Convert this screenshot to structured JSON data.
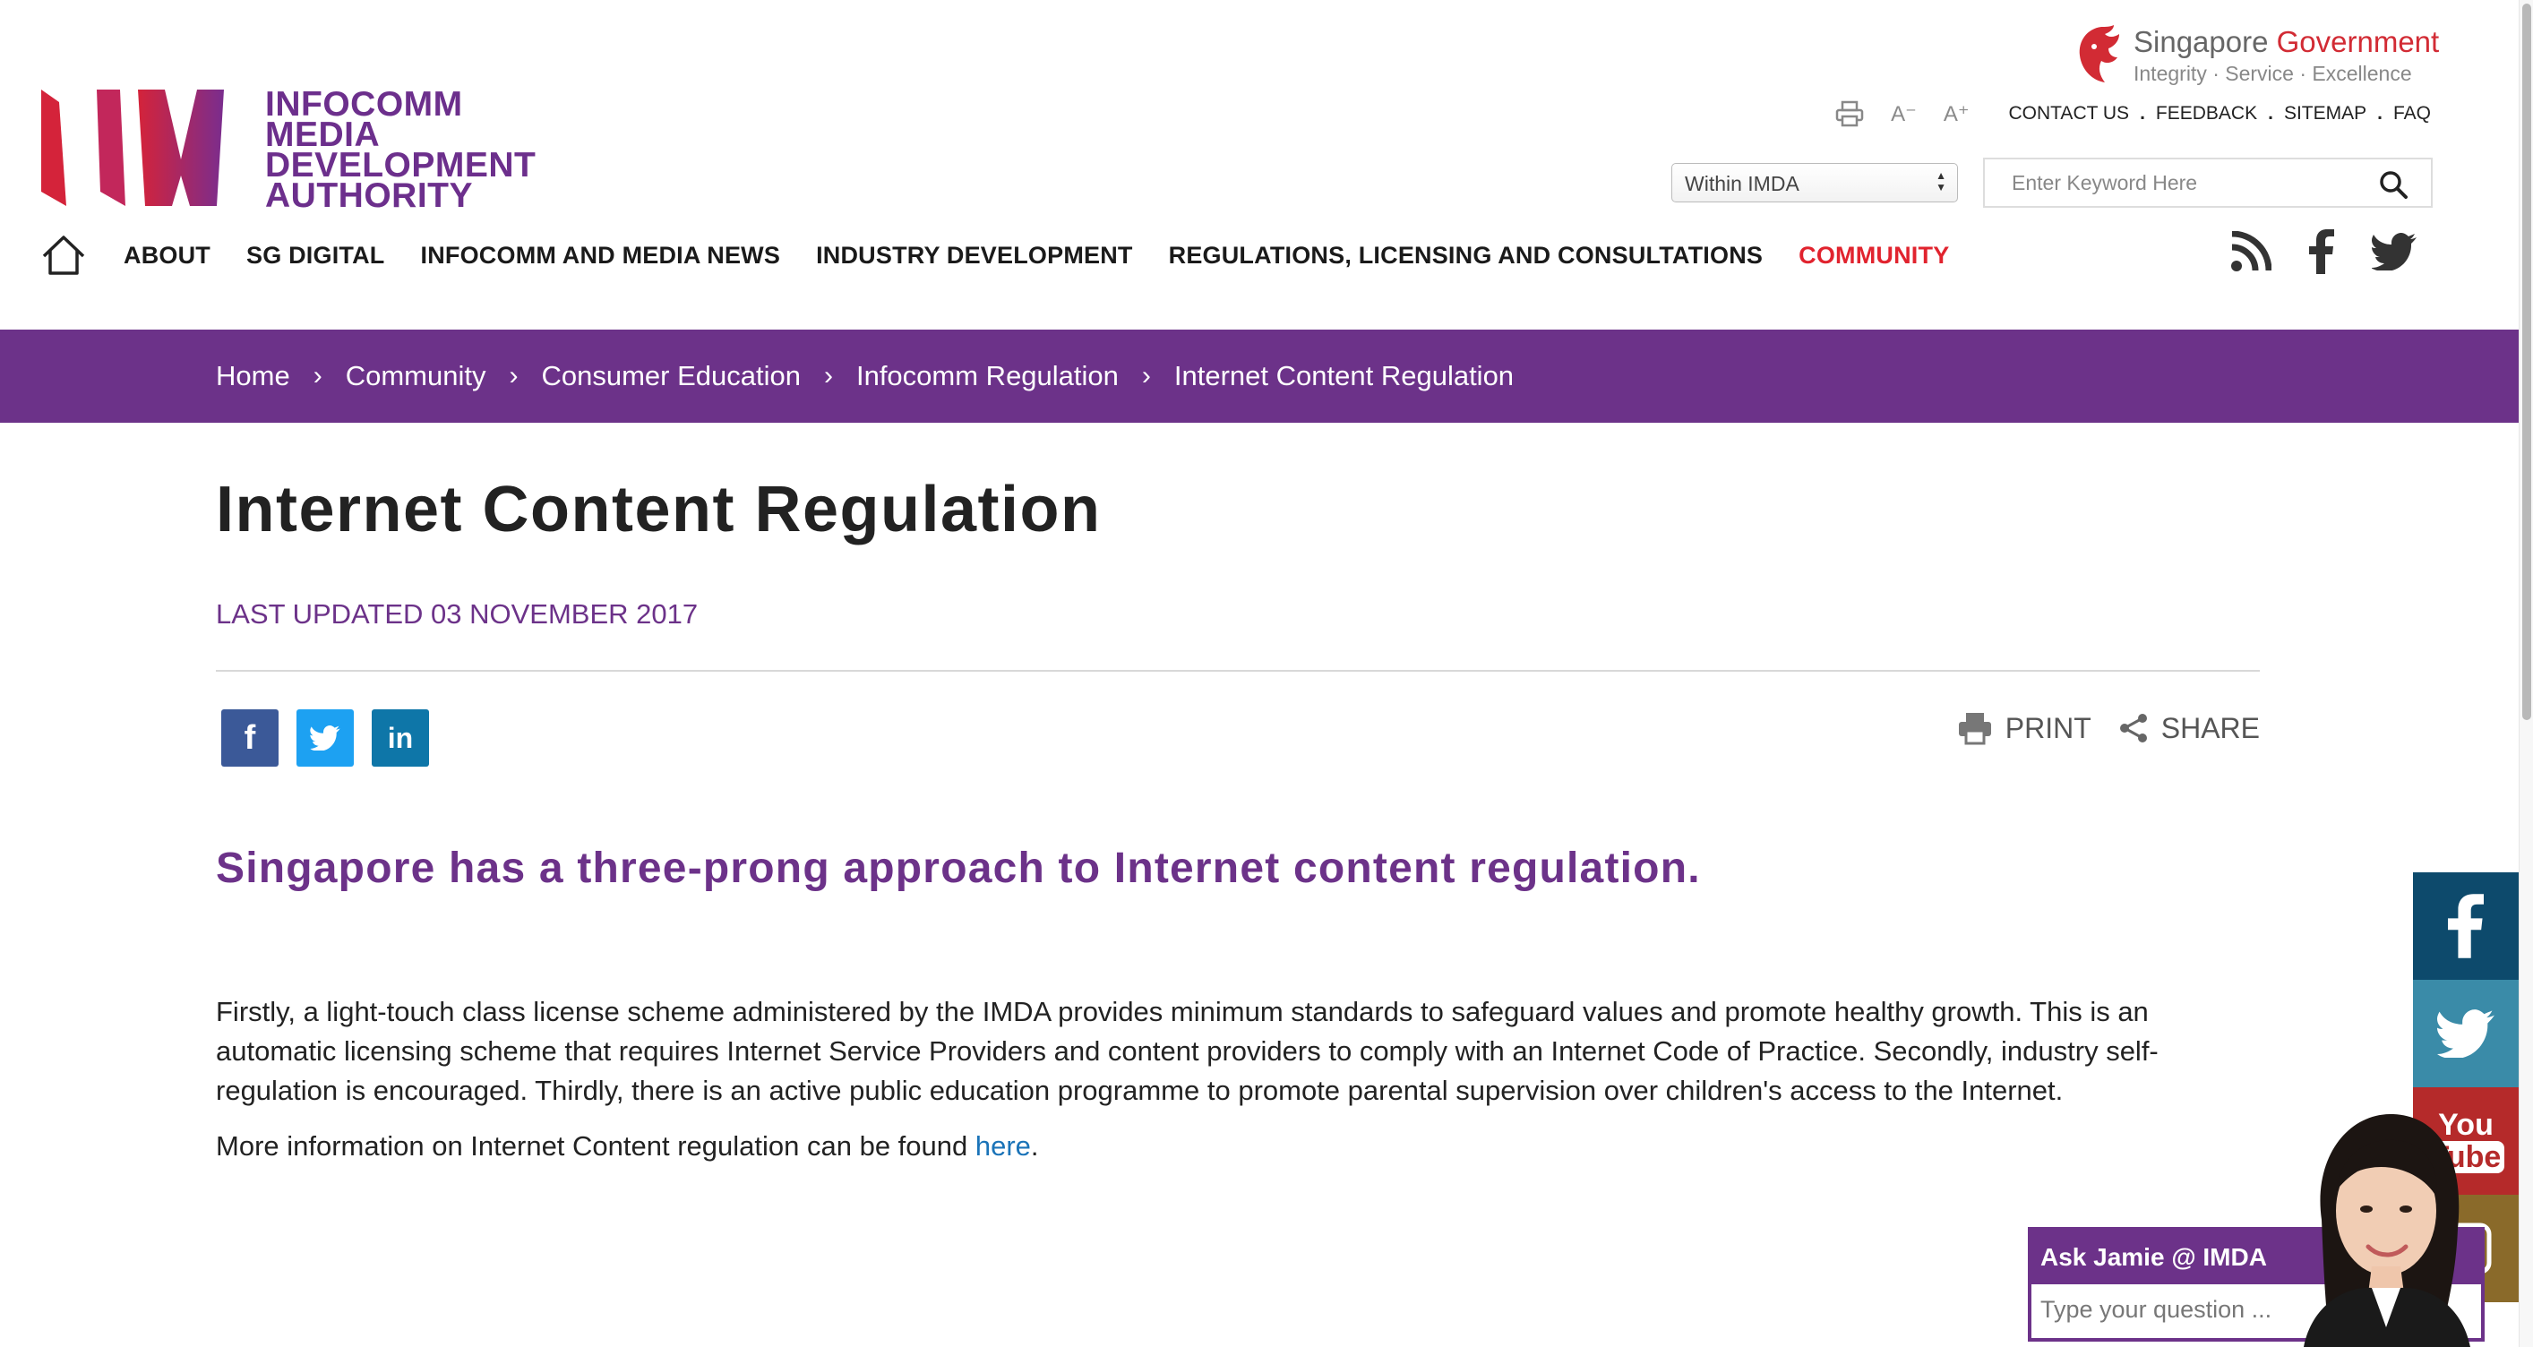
{
  "logo": {
    "lines": [
      "INFOCOMM",
      "MEDIA",
      "DEVELOPMENT",
      "AUTHORITY"
    ],
    "brand_color": "#6c2f8c",
    "accent_color": "#d22b34"
  },
  "sg_gov": {
    "title_part1": "Singapore ",
    "title_part2": "Government",
    "tagline": "Integrity · Service · Excellence"
  },
  "utility": {
    "font_decrease": "A⁻",
    "font_increase": "A⁺",
    "links": [
      "CONTACT US",
      "FEEDBACK",
      "SITEMAP",
      "FAQ"
    ],
    "separator": "."
  },
  "search": {
    "scope_value": "Within IMDA",
    "placeholder": "Enter Keyword Here"
  },
  "nav": {
    "items": [
      {
        "label": "ABOUT"
      },
      {
        "label": "SG DIGITAL"
      },
      {
        "label": "INFOCOMM AND MEDIA NEWS"
      },
      {
        "label": "INDUSTRY DEVELOPMENT"
      },
      {
        "label": "REGULATIONS, LICENSING AND CONSULTATIONS"
      },
      {
        "label": "COMMUNITY"
      }
    ],
    "active_color": "#e1232e"
  },
  "breadcrumb": {
    "items": [
      "Home",
      "Community",
      "Consumer Education",
      "Infocomm Regulation",
      "Internet Content Regulation"
    ],
    "bg_color": "#6c3289"
  },
  "page": {
    "title": "Internet Content Regulation",
    "updated": "LAST UPDATED 03 NOVEMBER 2017",
    "print_label": "PRINT",
    "share_label": "SHARE",
    "intro": "Singapore has a three-prong approach to Internet content regulation.",
    "paragraph": "Firstly, a light-touch class license scheme administered by the IMDA provides minimum standards to safeguard values and promote healthy growth. This is an automatic licensing scheme that requires Internet Service Providers and content providers to comply with an Internet Code of Practice. Secondly, industry self-regulation is encouraged. Thirdly, there is an active public education programme to promote parental supervision over children's access to the Internet.",
    "more_info_prefix": "More information on Internet Content regulation can be found ",
    "more_info_link": "here",
    "more_info_suffix": "."
  },
  "share_buttons": {
    "facebook": "f",
    "linkedin": "in"
  },
  "side_social": {
    "youtube_top": "You",
    "youtube_bottom": "Tube"
  },
  "chat": {
    "title": "Ask Jamie @ IMDA",
    "placeholder": "Type your question ..."
  }
}
